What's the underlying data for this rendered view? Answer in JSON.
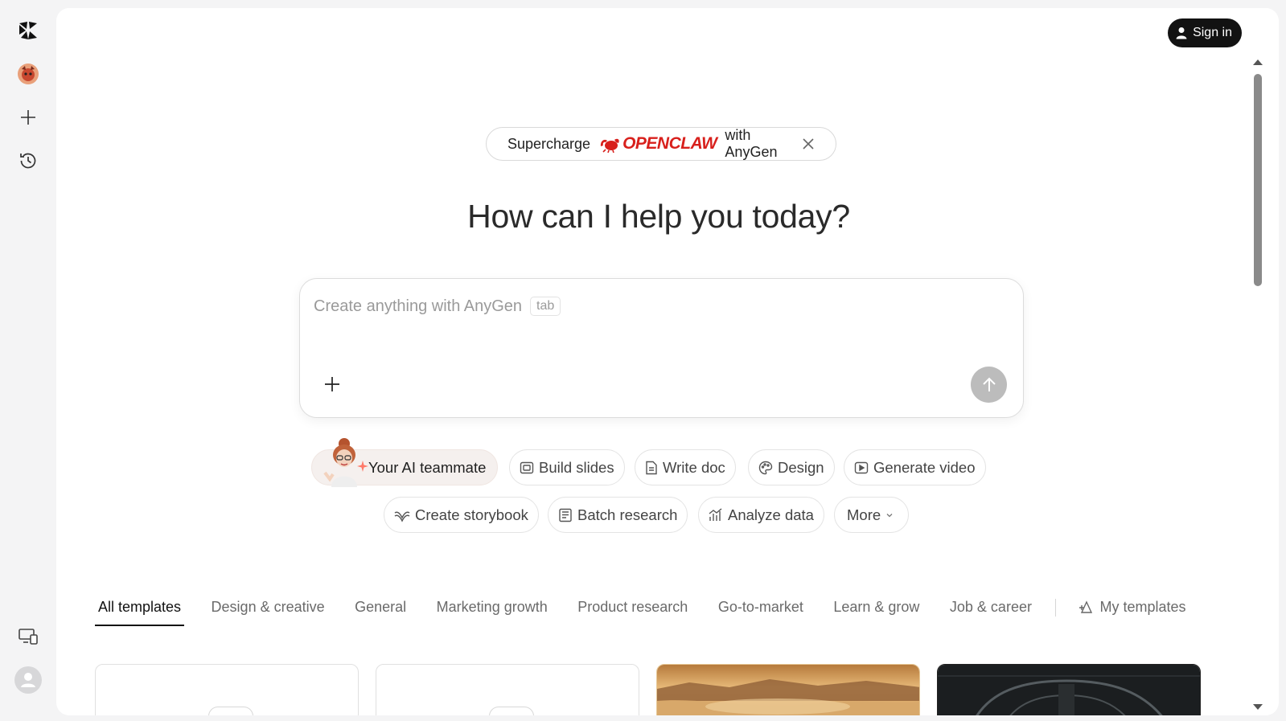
{
  "sidebar": {
    "items": [
      {
        "icon": "logo-icon"
      },
      {
        "icon": "user-avatar-icon"
      },
      {
        "icon": "plus-icon"
      },
      {
        "icon": "history-clock-icon"
      }
    ],
    "bottom": [
      {
        "icon": "devices-icon"
      },
      {
        "icon": "profile-icon"
      }
    ]
  },
  "header": {
    "signin_label": "Sign in"
  },
  "promo": {
    "prefix": "Supercharge",
    "brand": "OPENCLAW",
    "suffix": "with AnyGen"
  },
  "headline": "How can I help you today?",
  "composer": {
    "placeholder": "Create anything with AnyGen",
    "tab_hint": "tab"
  },
  "chips": {
    "ai_teammate": "Your AI teammate",
    "build_slides": "Build slides",
    "write_doc": "Write doc",
    "design": "Design",
    "generate_video": "Generate video",
    "create_storybook": "Create storybook",
    "batch_research": "Batch research",
    "analyze_data": "Analyze data",
    "more": "More"
  },
  "tabs": {
    "items": [
      "All templates",
      "Design & creative",
      "General",
      "Marketing growth",
      "Product research",
      "Go-to-market",
      "Learn & grow",
      "Job & career"
    ],
    "my_templates": "My templates",
    "active": "All templates"
  },
  "colors": {
    "accent_dark": "#121212",
    "brand_red": "#d8201c",
    "send_disabled": "#bcbcbc"
  }
}
